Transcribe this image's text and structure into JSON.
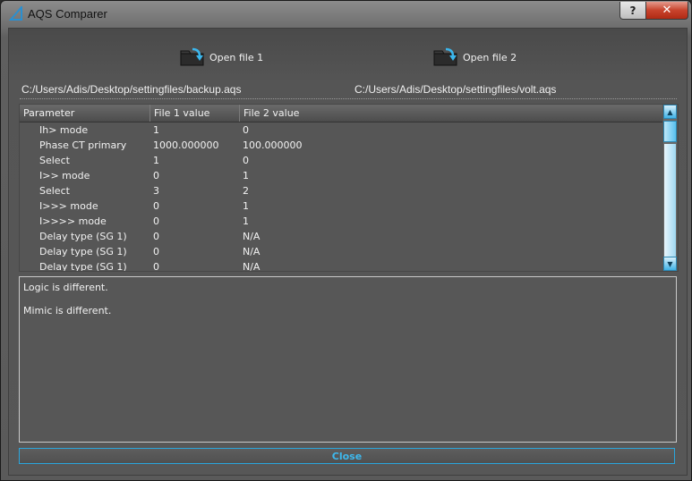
{
  "window": {
    "title": "AQS Comparer",
    "help_label": "?",
    "close_label": "✕"
  },
  "toolbar": {
    "open_file_1": "Open file 1",
    "open_file_2": "Open file 2"
  },
  "paths": {
    "file1": "C:/Users/Adis/Desktop/settingfiles/backup.aqs",
    "file2": "C:/Users/Adis/Desktop/settingfiles/volt.aqs"
  },
  "grid": {
    "columns": [
      "Parameter",
      "File 1 value",
      "File 2 value"
    ],
    "rows": [
      {
        "parameter": "Ih> mode",
        "file1": "1",
        "file2": "0"
      },
      {
        "parameter": "Phase CT primary",
        "file1": "1000.000000",
        "file2": "100.000000"
      },
      {
        "parameter": "Select",
        "file1": "1",
        "file2": "0"
      },
      {
        "parameter": "I>> mode",
        "file1": "0",
        "file2": "1"
      },
      {
        "parameter": "Select",
        "file1": "3",
        "file2": "2"
      },
      {
        "parameter": "I>>> mode",
        "file1": "0",
        "file2": "1"
      },
      {
        "parameter": "I>>>> mode",
        "file1": "0",
        "file2": "1"
      },
      {
        "parameter": "Delay type (SG 1)",
        "file1": "0",
        "file2": "N/A"
      },
      {
        "parameter": "Delay type (SG 1)",
        "file1": "0",
        "file2": "N/A"
      },
      {
        "parameter": "Delay type (SG 1)",
        "file1": "0",
        "file2": "N/A"
      }
    ]
  },
  "log": {
    "lines": [
      "Logic is different.",
      "Mimic is different."
    ]
  },
  "footer": {
    "close_label": "Close"
  },
  "colors": {
    "accent": "#2aa6dd",
    "scrollbar": "#57c0ee"
  }
}
